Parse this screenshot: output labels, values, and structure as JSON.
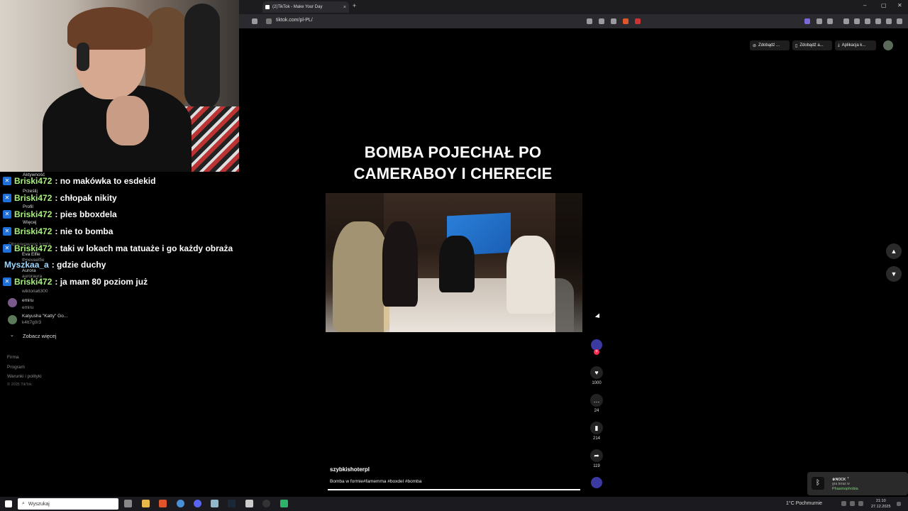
{
  "browser": {
    "tab_title": "(2)TikTok - Make Your Day",
    "tab_close": "×",
    "new_tab": "+",
    "url": "tiktok.com/pl-PL/",
    "window_controls": [
      "–",
      "▢",
      "✕"
    ]
  },
  "tiktok": {
    "top_buttons": [
      "Zdobądź ...",
      "Zdobądź a...",
      "Aplikacja k..."
    ],
    "video": {
      "title_line1": "BOMBA POJECHAŁ PO",
      "title_line2": "CAMERABOY I CHERECIE",
      "username": "szybkishoterpl",
      "caption": "Bomba w formie#famemma #boxdel #bomba",
      "progress": 1.0
    },
    "actions": {
      "follow": "+",
      "likes": "1000",
      "comments": "24",
      "saves": "214",
      "shares": "119"
    },
    "nav": {
      "up": "▲",
      "down": "▼"
    }
  },
  "sidebar": {
    "items": [
      "Aktywność",
      "Prześlij",
      "Profil",
      "Więcej",
      "Obserwowane konta"
    ],
    "accounts": [
      {
        "name": "Eva Elfie",
        "handle": "theevaelfie"
      },
      {
        "name": "Aurora",
        "handle": "auroraura"
      },
      {
        "name": "wiktoria6300",
        "handle": "wiktoria6300"
      },
      {
        "name": "emiru",
        "handle": "emiru"
      },
      {
        "name": "Katyusha \"Katty\" Go...",
        "handle": "k4tt7g0r3"
      }
    ],
    "see_more": "Zobacz więcej",
    "footer": [
      "Firma",
      "Program",
      "Warunki i polityki",
      "© 2025 TikTok"
    ]
  },
  "chat": [
    {
      "user": "Briski472",
      "msg": ": no makówka to esdekid"
    },
    {
      "user": "Briski472",
      "msg": ": chłopak nikity"
    },
    {
      "user": "Briski472",
      "msg": ": pies bboxdela"
    },
    {
      "user": "Briski472",
      "msg": ": nie to bomba"
    },
    {
      "user": "Briski472",
      "msg": ": taki w lokach ma tatuaże i go każdy obraża"
    },
    {
      "user": "Myszkaa_a",
      "msg": ": gdzie duchy"
    },
    {
      "user": "Briski472",
      "msg": ": ja mam 80 poziom już"
    }
  ],
  "taskbar": {
    "search_placeholder": "Wyszukaj",
    "weather": "1°C  Pochmurnie",
    "time": "21:10",
    "date": "27.12.2025"
  },
  "notification": {
    "title": "๑ɴᴏᴄᴋ ᐪ",
    "subtitle": "gra teraz w",
    "game": "Phasmophobia"
  },
  "colors": {
    "accent": "#fe2c55",
    "chat_user": "#a6ef7a",
    "chat_user_alt": "#9ed7ff"
  }
}
